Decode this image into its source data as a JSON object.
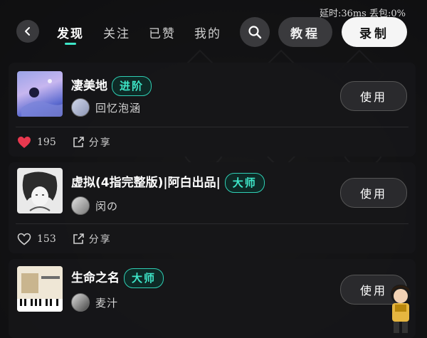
{
  "status": {
    "latency": "延时:36ms 丢包:0%"
  },
  "nav": {
    "tabs": [
      {
        "label": "发现",
        "active": true
      },
      {
        "label": "关注",
        "active": false
      },
      {
        "label": "已赞",
        "active": false
      },
      {
        "label": "我的",
        "active": false
      }
    ],
    "tutorial_label": "教程",
    "record_label": "录制"
  },
  "cards": [
    {
      "title": "凄美地",
      "badge": "进阶",
      "author": "回忆泡涵",
      "use_label": "使用",
      "likes": "195",
      "liked": true,
      "share_label": "分享"
    },
    {
      "title": "虚拟(4指完整版)|阿白出品|",
      "badge": "大师",
      "author": "闵の",
      "use_label": "使用",
      "likes": "153",
      "liked": false,
      "share_label": "分享"
    },
    {
      "title": "生命之名",
      "badge": "大师",
      "author": "麦汁",
      "use_label": "使用"
    }
  ],
  "colors": {
    "accent": "#3ee6c8",
    "like": "#e8384f",
    "panel": "#161618"
  }
}
